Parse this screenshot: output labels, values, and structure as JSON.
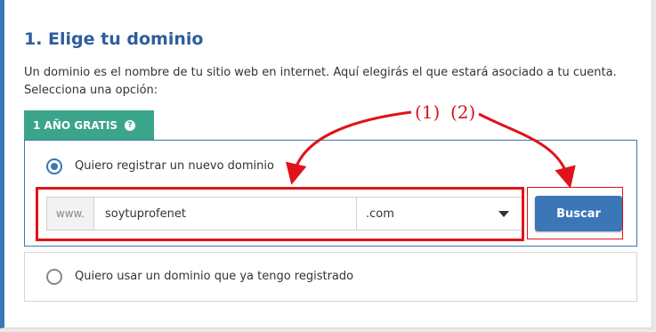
{
  "section": {
    "title": "1. Elige tu dominio",
    "description": "Un dominio es el nombre de tu sitio web en internet. Aquí elegirás el que estará asociado a tu cuenta. Selecciona una opción:"
  },
  "badge": {
    "label": "1 AÑO GRATIS",
    "icon": "question-circle-icon"
  },
  "option_new": {
    "label": "Quiero registrar un nuevo dominio",
    "selected": true,
    "prefix": "www.",
    "domain_value": "soytuprofenet",
    "tld_selected": ".com",
    "search_button": "Buscar"
  },
  "option_existing": {
    "label": "Quiero usar un dominio que ya tengo registrado",
    "selected": false
  },
  "annotations": {
    "label1": "(1)",
    "label2": "(2)"
  },
  "colors": {
    "accent": "#3b76b7",
    "badge": "#3aa58a",
    "annotation": "#e0131a"
  }
}
